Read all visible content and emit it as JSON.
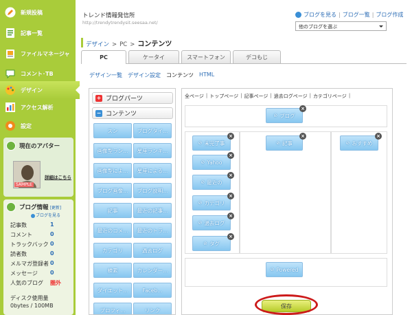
{
  "sidebar": {
    "items": [
      {
        "label": "新規投稿",
        "icon": "pencil-icon"
      },
      {
        "label": "記事一覧",
        "icon": "article-list-icon"
      },
      {
        "label": "ファイルマネージャ",
        "icon": "file-manager-icon"
      },
      {
        "label": "コメント･TB",
        "icon": "comment-icon"
      },
      {
        "label": "デザイン",
        "icon": "palette-icon",
        "active": true
      },
      {
        "label": "アクセス解析",
        "icon": "bar-chart-icon"
      },
      {
        "label": "設定",
        "icon": "gear-icon"
      }
    ],
    "avatar_box": {
      "title": "現在のアバター",
      "sample_label": "SAMPLE",
      "details_link": "詳細はこちら"
    },
    "blog_info": {
      "title": "ブログ情報",
      "update_link": "[更新]",
      "view_blog_link": "ブログを見る",
      "stats": [
        {
          "label": "記事数",
          "value": "1"
        },
        {
          "label": "コメント",
          "value": "0"
        },
        {
          "label": "トラックバック",
          "value": "0"
        },
        {
          "label": "読者数",
          "value": "0"
        },
        {
          "label": "メルマガ登録者",
          "value": "0"
        },
        {
          "label": "メッセージ",
          "value": "0"
        },
        {
          "label": "人気のブログ",
          "value": "圏外",
          "color": "#e33333"
        }
      ],
      "disk_label": "ディスク使用量",
      "disk_value": "0bytes / 100MB"
    }
  },
  "header": {
    "blog_name": "トレンド情報発信所",
    "blog_url": "http://trendytrendysit.seesaa.net/",
    "links": [
      "ブログを見る",
      "ブログ一覧",
      "ブログ作成"
    ],
    "blog_select": "他のブログを選ぶ"
  },
  "breadcrumb": {
    "link": "デザイン",
    "sep": ">",
    "mid": "PC",
    "current": "コンテンツ"
  },
  "device_tabs": [
    "PC",
    "ケータイ",
    "スマートフォン",
    "デコもじ"
  ],
  "sub_nav": [
    {
      "label": "デザイン一覧",
      "current": false
    },
    {
      "label": "デザイン設定",
      "current": false
    },
    {
      "label": "コンテンツ",
      "current": true
    },
    {
      "label": "HTML",
      "current": false
    }
  ],
  "parts_panel": {
    "blog_parts_title": "ブログパーツ",
    "contents_title": "コンテンツ",
    "items": [
      [
        "スン",
        "ブログタイ..."
      ],
      [
        "画像型ラン...",
        "星座ランキ..."
      ],
      [
        "画像型によ...",
        "星座による..."
      ],
      [
        "ブログ画像...",
        "ブログ説明..."
      ],
      [
        "記事",
        "最近の記事..."
      ],
      [
        "最近のコメ...",
        "最近のトラ..."
      ],
      [
        "カテゴリ",
        "過去ログ"
      ],
      [
        "検索",
        "カレンダー..."
      ],
      [
        "ダイエット...",
        "Faceb..."
      ],
      [
        "プロフィ...",
        "リンク"
      ]
    ]
  },
  "layout_panel": {
    "page_links": [
      "全ページ",
      "トップページ",
      "記事ページ",
      "過去ログページ",
      "カテゴリページ"
    ],
    "header_block": "ブログ",
    "left_column": [
      "未完了事",
      "Yahoo",
      "最近の",
      "カテゴリ",
      "過去ログ",
      "タグ"
    ],
    "center_column": [
      "記事"
    ],
    "right_column": [
      "おすすめ"
    ],
    "footer_block": "Powered"
  },
  "save_label": "保存",
  "colors": {
    "sidebar": "#a9cc3a",
    "link": "#2b6cb5",
    "part_block": "#87c7f0",
    "highlight": "#cc1a1a"
  }
}
